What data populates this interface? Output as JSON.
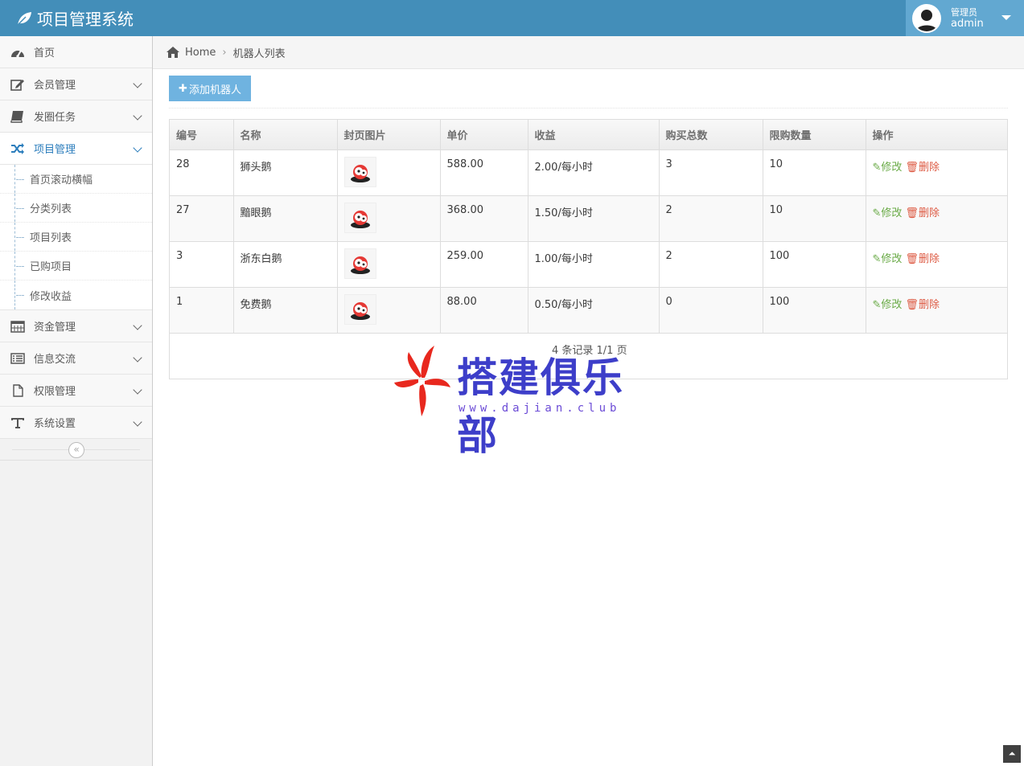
{
  "header": {
    "brand_title": "项目管理系统",
    "user_role": "管理员",
    "user_name": "admin"
  },
  "colors": {
    "navbar": "#438eb9",
    "accent": "#2b7dbc",
    "edit": "#69aa46",
    "delete": "#dd5a43"
  },
  "sidebar": {
    "items": [
      {
        "label": "首页",
        "icon": "dashboard-icon"
      },
      {
        "label": "会员管理",
        "icon": "edit-icon"
      },
      {
        "label": "发圈任务",
        "icon": "book-icon"
      },
      {
        "label": "项目管理",
        "icon": "random-icon"
      },
      {
        "label": "资金管理",
        "icon": "calendar-icon"
      },
      {
        "label": "信息交流",
        "icon": "list-icon"
      },
      {
        "label": "权限管理",
        "icon": "file-icon"
      },
      {
        "label": "系统设置",
        "icon": "text-icon"
      }
    ],
    "submenu": [
      {
        "label": "首页滚动横幅"
      },
      {
        "label": "分类列表"
      },
      {
        "label": "项目列表"
      },
      {
        "label": "已购项目"
      },
      {
        "label": "修改收益"
      }
    ]
  },
  "breadcrumb": {
    "home": "Home",
    "current": "机器人列表"
  },
  "toolbar": {
    "add_label": "添加机器人"
  },
  "table": {
    "headers": [
      "编号",
      "名称",
      "封页图片",
      "单价",
      "收益",
      "购买总数",
      "限购数量",
      "操作"
    ],
    "rows": [
      {
        "id": "28",
        "name": "狮头鹅",
        "price": "588.00",
        "income": "2.00/每小时",
        "total": "3",
        "limit": "10"
      },
      {
        "id": "27",
        "name": "黯眼鹅",
        "price": "368.00",
        "income": "1.50/每小时",
        "total": "2",
        "limit": "10"
      },
      {
        "id": "3",
        "name": "浙东白鹅",
        "price": "259.00",
        "income": "1.00/每小时",
        "total": "2",
        "limit": "100"
      },
      {
        "id": "1",
        "name": "免费鹅",
        "price": "88.00",
        "income": "0.50/每小时",
        "total": "0",
        "limit": "100"
      }
    ],
    "edit_label": "修改",
    "delete_label": "删除",
    "pager": "4 条记录 1/1 页"
  },
  "watermark": {
    "text": "搭建俱乐部",
    "url": "www.dajian.club"
  }
}
